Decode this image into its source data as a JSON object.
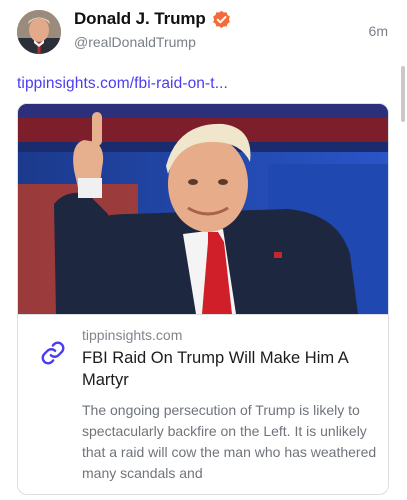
{
  "post": {
    "display_name": "Donald J. Trump",
    "handle": "@realDonaldTrump",
    "timestamp": "6m",
    "link_text": "tippinsights.com/fbi-raid-on-t...",
    "verified_icon": "verified-badge-icon",
    "accent_color": "#4a3df0",
    "badge_color": "#f26b3a"
  },
  "card": {
    "domain": "tippinsights.com",
    "title": "FBI Raid On Trump Will Make Him A Martyr",
    "description": "The ongoing persecution of Trump is likely to spectacularly backfire on the Left. It is unlikely that a raid will cow the man who has weathered many scandals and",
    "link_icon": "link-icon",
    "image_subject": "photo-thumbs-up"
  }
}
